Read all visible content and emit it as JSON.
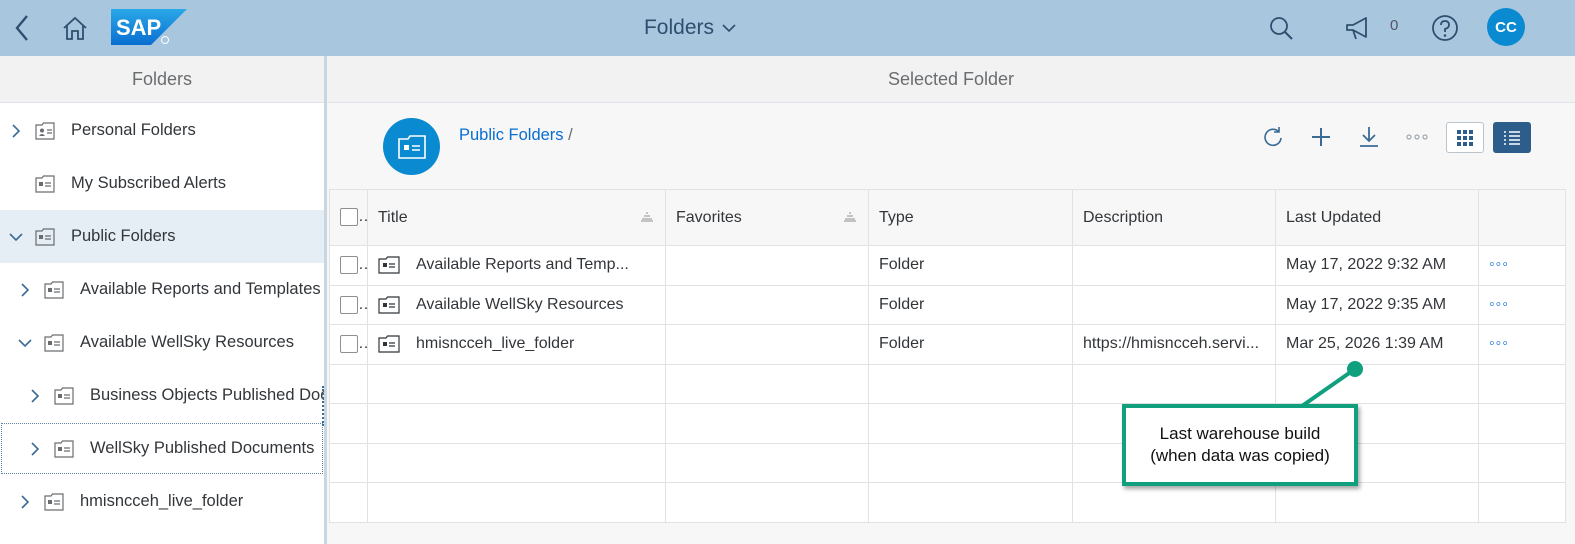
{
  "shell": {
    "title": "Folders",
    "notification_count": "0",
    "avatar_initials": "CC",
    "logo_text": "SAP",
    "accent": "#0a8ad1",
    "bar_color": "#a9c6df"
  },
  "left_pane": {
    "header": "Folders",
    "items": [
      {
        "label": "Personal Folders",
        "expander": "collapsed",
        "icon": "personal-folder-icon"
      },
      {
        "label": "My Subscribed Alerts",
        "expander": "none",
        "icon": "folder-icon"
      },
      {
        "label": "Public Folders",
        "expander": "expanded",
        "icon": "folder-icon"
      },
      {
        "label": "Available Reports and Templates",
        "expander": "collapsed",
        "icon": "folder-icon"
      },
      {
        "label": "Available WellSky Resources",
        "expander": "expanded",
        "icon": "folder-icon"
      },
      {
        "label": "Business Objects Published Documents",
        "expander": "collapsed",
        "icon": "folder-icon"
      },
      {
        "label": "WellSky Published Documents",
        "expander": "collapsed",
        "icon": "folder-icon"
      },
      {
        "label": "hmisncceh_live_folder",
        "expander": "collapsed",
        "icon": "folder-icon"
      }
    ]
  },
  "right_pane": {
    "header": "Selected Folder",
    "breadcrumb": {
      "link": "Public Folders",
      "separator": "/"
    },
    "table": {
      "columns": [
        "Title",
        "Favorites",
        "Type",
        "Description",
        "Last Updated"
      ],
      "rows": [
        {
          "title": "Available Reports and Temp...",
          "favorites": "",
          "type": "Folder",
          "description": "",
          "last_updated": "May 17, 2022 9:32 AM",
          "more": "◦◦◦"
        },
        {
          "title": "Available WellSky Resources",
          "favorites": "",
          "type": "Folder",
          "description": "",
          "last_updated": "May 17, 2022 9:35 AM",
          "more": "◦◦◦"
        },
        {
          "title": "hmisncceh_live_folder",
          "favorites": "",
          "type": "Folder",
          "description": "https://hmisncceh.servi...",
          "last_updated": "Mar 25, 2026 1:39 AM",
          "more": "◦◦◦"
        }
      ]
    }
  },
  "callout": {
    "line1": "Last warehouse build",
    "line2": "(when data was copied)",
    "color": "#11a07e"
  }
}
